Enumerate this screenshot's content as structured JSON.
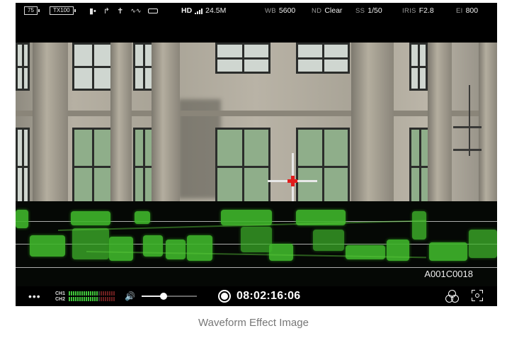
{
  "status": {
    "battery": "75",
    "tx_battery": "TX100",
    "resolution": "HD",
    "bitrate": "24.5M",
    "wb_label": "WB",
    "wb_value": "5600",
    "nd_label": "ND",
    "nd_value": "Clear",
    "ss_label": "SS",
    "ss_value": "1/50",
    "iris_label": "IRIS",
    "iris_value": "F2.8",
    "ei_label": "EI",
    "ei_value": "800",
    "icons": [
      "card-icon",
      "usb-icon",
      "person-icon",
      "wireless-icon",
      "hdmi-icon",
      "signal-icon"
    ]
  },
  "monitor": {
    "clip_name": "A001C0018",
    "timecode": "08:02:16:06",
    "audio_channels": [
      "CH1",
      "CH2"
    ],
    "audio_level": 0.62,
    "volume_level": 0.4,
    "colors": {
      "waveform": "#3fb52b",
      "crosshair": "#e21c1c",
      "meter": "#3fc43a"
    }
  },
  "caption": "Waveform Effect Image"
}
